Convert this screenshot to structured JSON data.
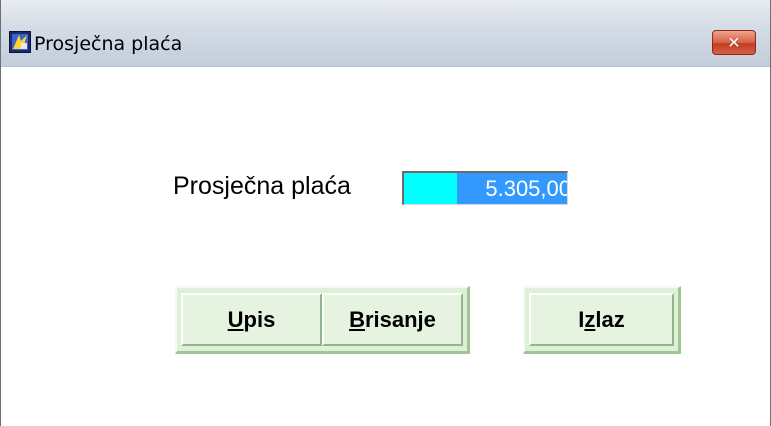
{
  "window": {
    "title": "Prosječna plaća",
    "close_label": "✕"
  },
  "form": {
    "label": "Prosječna plaća",
    "amount_value": "5.305,00"
  },
  "buttons": {
    "upis": {
      "mnemonic": "U",
      "rest": "pis"
    },
    "brisanje": {
      "mnemonic": "B",
      "rest": "risanje"
    },
    "izlaz": {
      "prefix": "I",
      "mnemonic": "z",
      "rest": "laz"
    }
  },
  "colors": {
    "field_background": "#00ffff",
    "selection": "#3399ff",
    "button_face": "#e6f3e1",
    "close_button": "#c94a33"
  }
}
